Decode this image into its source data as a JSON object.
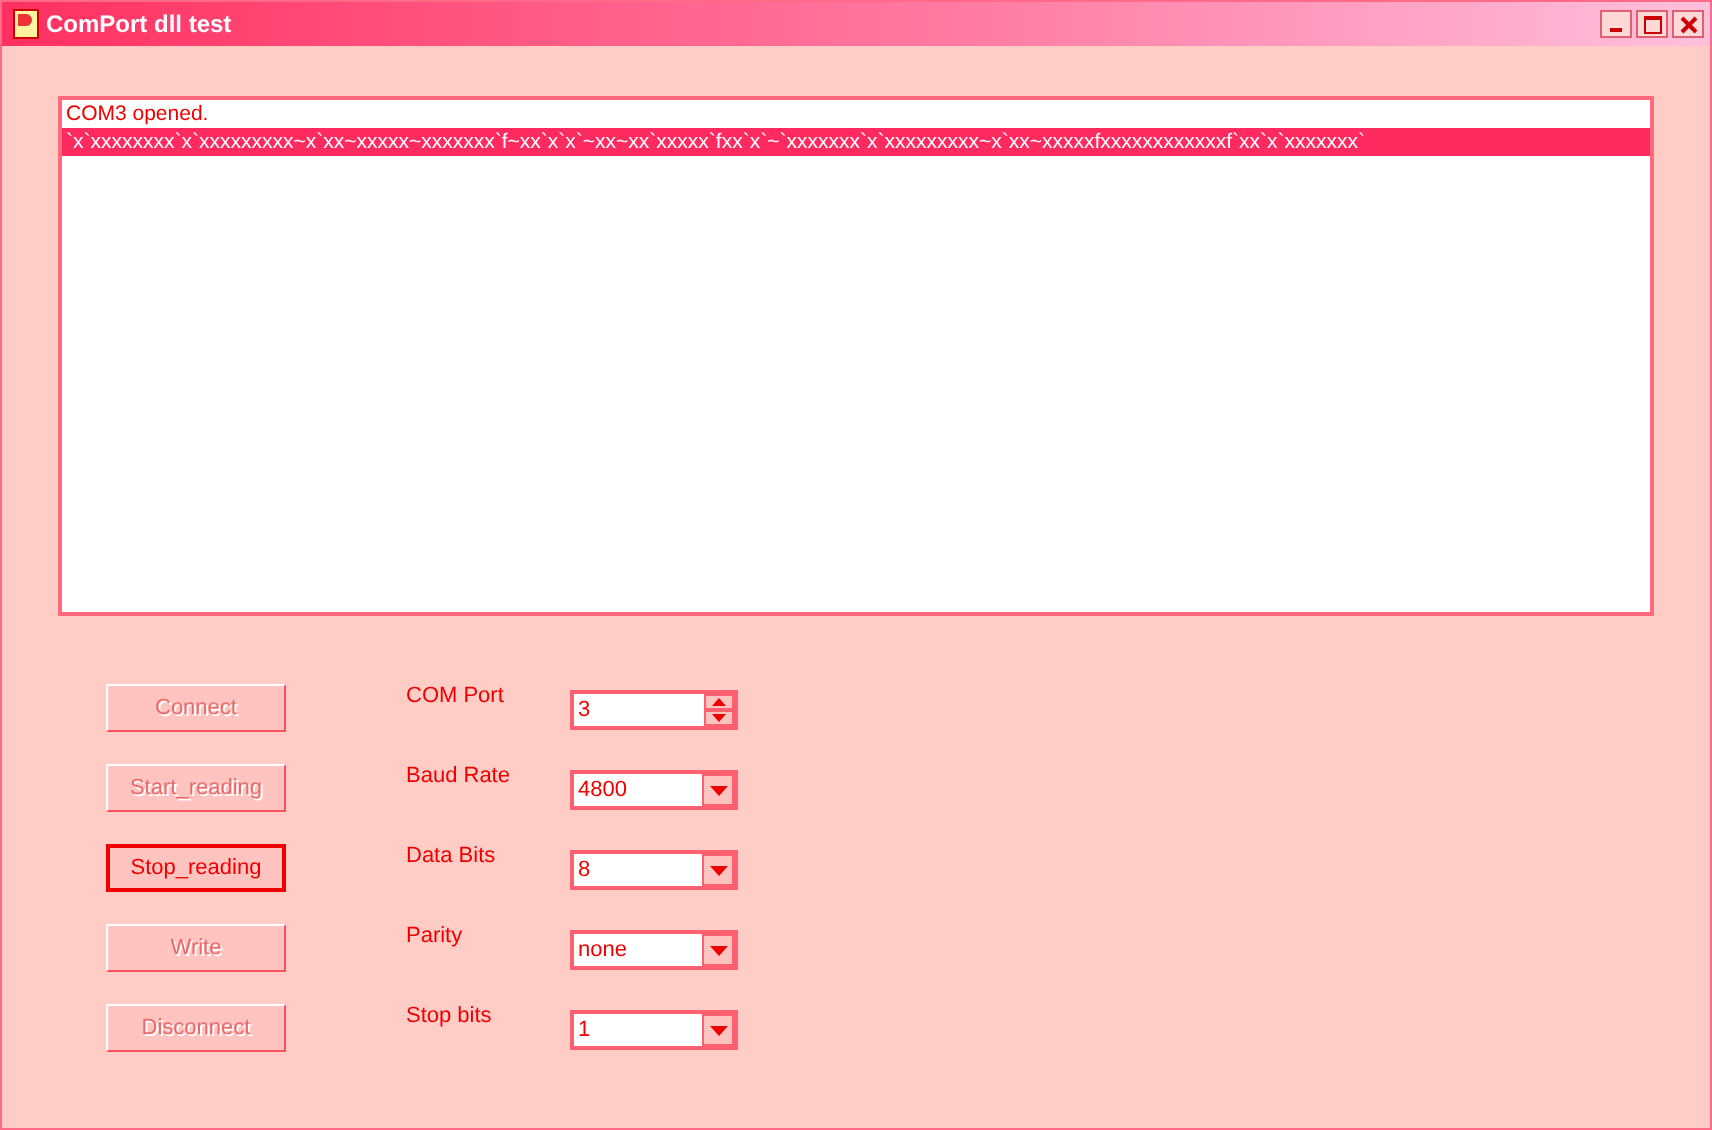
{
  "window": {
    "title": "ComPort dll test"
  },
  "log": {
    "items": [
      {
        "text": "COM3 opened.",
        "selected": false
      },
      {
        "text": "`x`xxxxxxxx`x`xxxxxxxxx~x`xx~xxxxx~xxxxxxx`f~xx`x`x`~xx~xx`xxxxx`fxx`x`~`xxxxxxx`x`xxxxxxxxx~x`xx~xxxxxfxxxxxxxxxxxxf`xx`x`xxxxxxx`",
        "selected": true
      }
    ]
  },
  "buttons": [
    {
      "label": "Connect",
      "disabled": true
    },
    {
      "label": "Start_reading",
      "disabled": true
    },
    {
      "label": "Stop_reading",
      "disabled": false
    },
    {
      "label": "Write",
      "disabled": true
    },
    {
      "label": "Disconnect",
      "disabled": true
    }
  ],
  "settings": [
    {
      "label": "COM Port",
      "kind": "spin",
      "value": "3"
    },
    {
      "label": "Baud Rate",
      "kind": "dropdown",
      "value": "4800"
    },
    {
      "label": "Data Bits",
      "kind": "dropdown",
      "value": "8"
    },
    {
      "label": "Parity",
      "kind": "dropdown",
      "value": "none"
    },
    {
      "label": "Stop bits",
      "kind": "dropdown",
      "value": "1"
    }
  ]
}
